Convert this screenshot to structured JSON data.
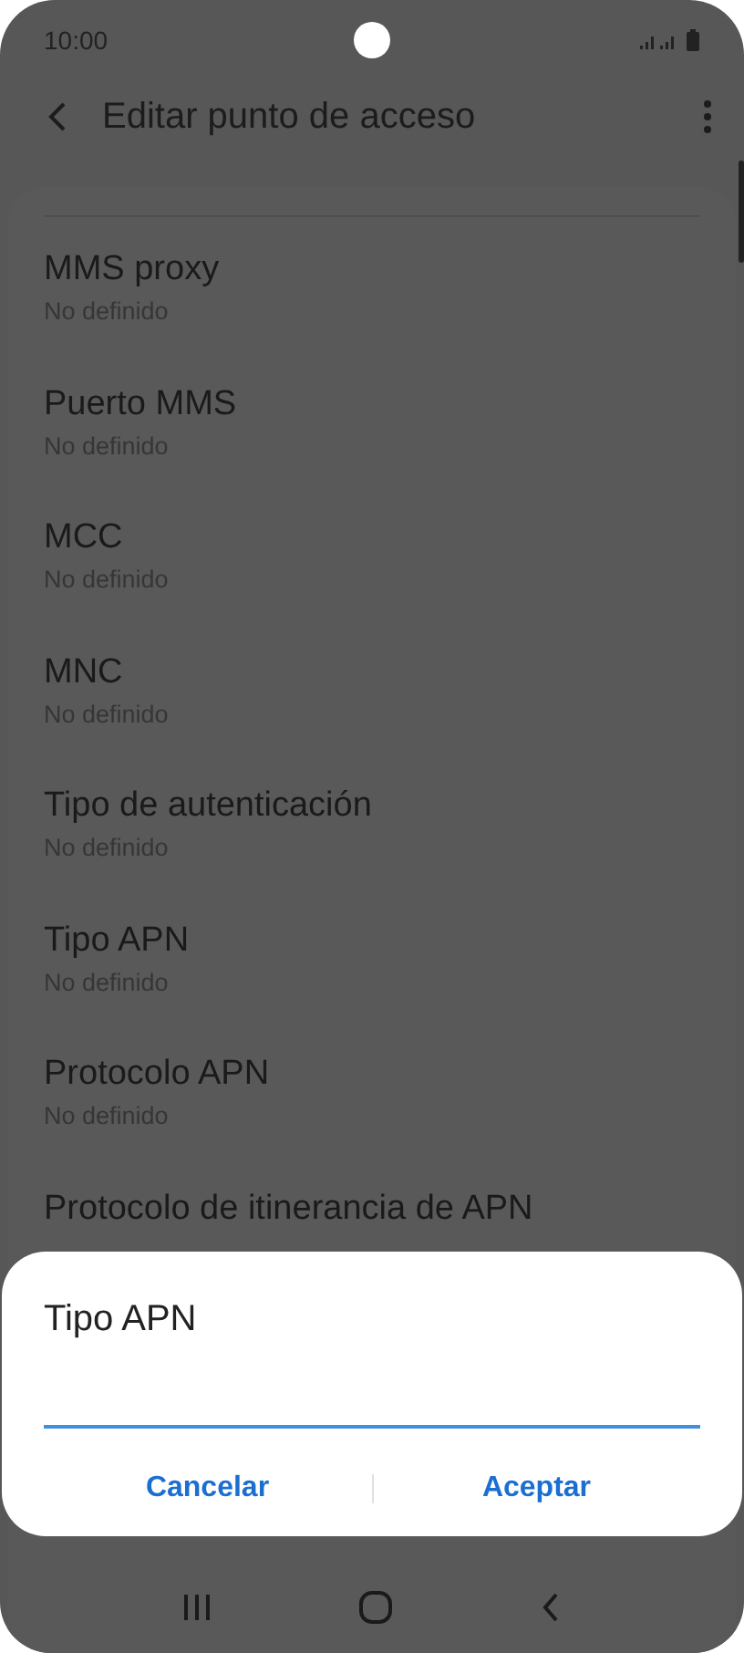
{
  "status_bar": {
    "time": "10:00"
  },
  "header": {
    "title": "Editar punto de acceso"
  },
  "items": [
    {
      "title": "MMS proxy",
      "value": "No definido"
    },
    {
      "title": "Puerto MMS",
      "value": "No definido"
    },
    {
      "title": "MCC",
      "value": "No definido"
    },
    {
      "title": "MNC",
      "value": "No definido"
    },
    {
      "title": "Tipo de autenticación",
      "value": "No definido"
    },
    {
      "title": "Tipo APN",
      "value": "No definido"
    },
    {
      "title": "Protocolo APN",
      "value": "No definido"
    },
    {
      "title": "Protocolo de itinerancia de APN"
    }
  ],
  "dialog": {
    "title": "Tipo APN",
    "buttons": [
      "Cancelar",
      "Aceptar"
    ]
  }
}
